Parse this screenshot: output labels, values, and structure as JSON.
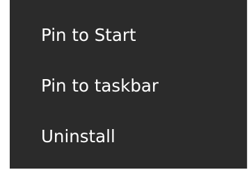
{
  "context_menu": {
    "items": [
      {
        "label": "Pin to Start"
      },
      {
        "label": "Pin to taskbar"
      },
      {
        "label": "Uninstall"
      }
    ]
  },
  "colors": {
    "menu_background": "#2b2b2b",
    "menu_text": "#ffffff",
    "page_background": "#ffffff"
  }
}
